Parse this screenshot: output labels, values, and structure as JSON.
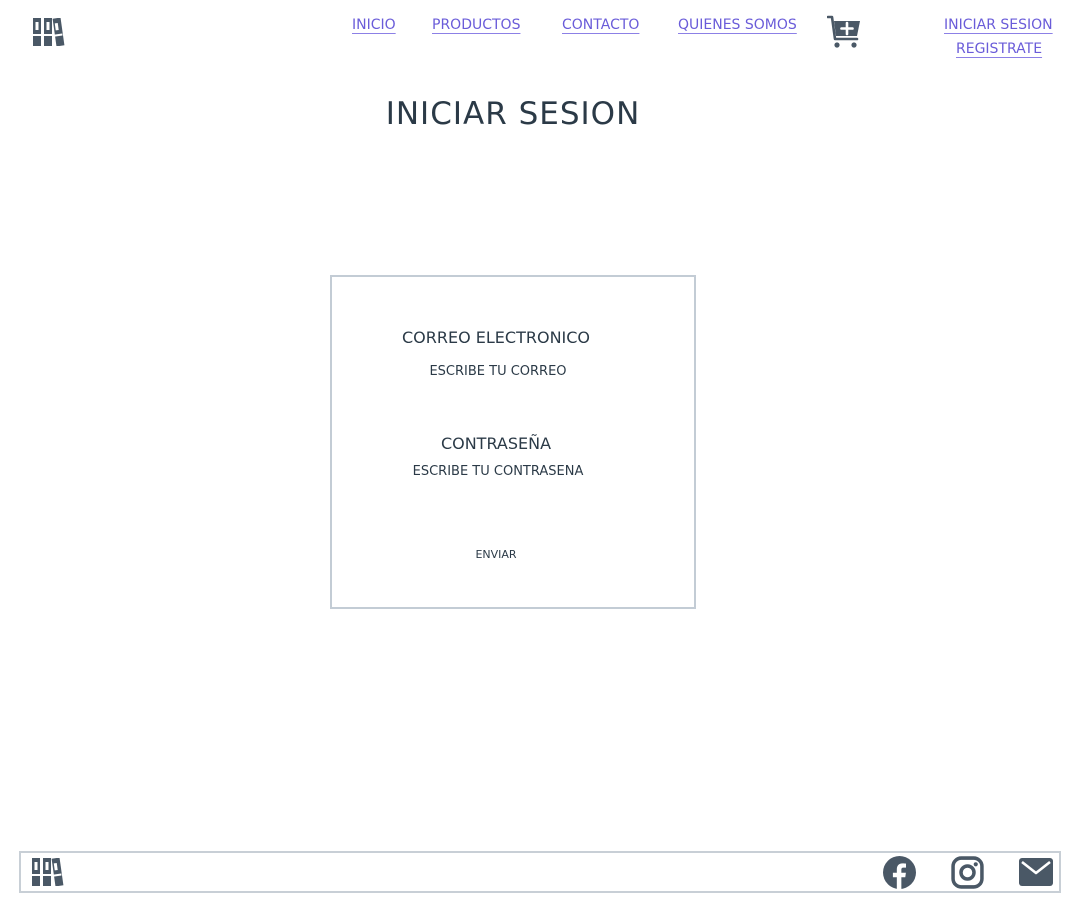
{
  "header": {
    "logo_icon": "books-logo-icon",
    "nav": {
      "inicio": "INICIO",
      "productos": "PRODUCTOS",
      "contacto": "CONTACTO",
      "quienes_somos": "QUIENES SOMOS"
    },
    "cart_icon": "cart-plus-icon",
    "auth": {
      "login": "INICIAR SESION",
      "register": "REGISTRATE"
    }
  },
  "main": {
    "title": "INICIAR SESION",
    "form": {
      "email_label": "CORREO ELECTRONICO",
      "email_placeholder": "ESCRIBE TU CORREO",
      "email_value": "",
      "password_label": "CONTRASEÑA",
      "password_placeholder": "ESCRIBE TU CONTRASEÑA",
      "password_value": "",
      "submit_label": "ENVIAR"
    }
  },
  "footer": {
    "logo_icon": "books-logo-icon",
    "social_icons": [
      "facebook-icon",
      "instagram-icon",
      "mail-icon"
    ]
  },
  "colors": {
    "text": "#2b3a47",
    "link": "#6a5cd9",
    "border": "#c3ccd5"
  }
}
